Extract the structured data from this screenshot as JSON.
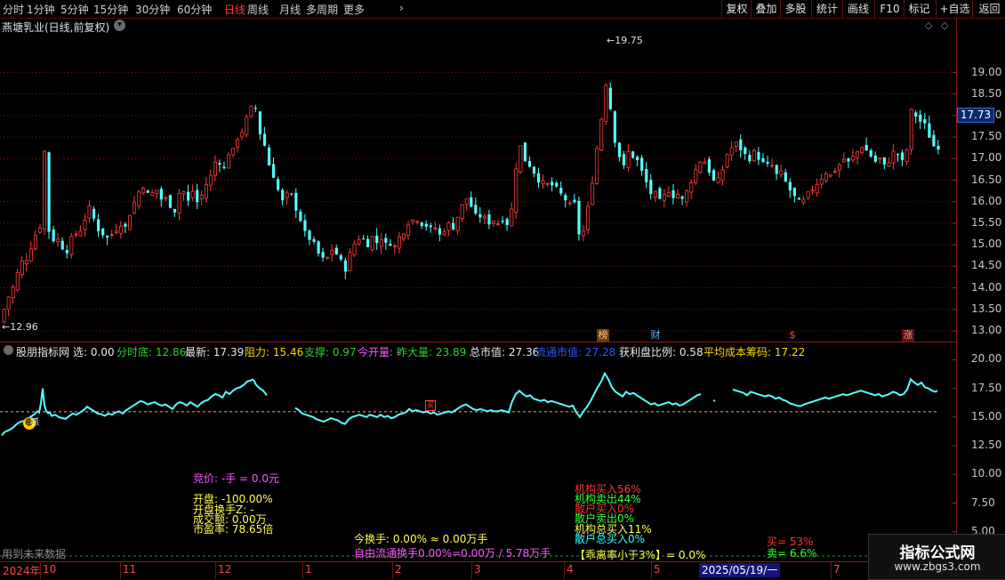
{
  "toolbar": {
    "periods": [
      "分时",
      "1分钟",
      "5分钟",
      "15分钟",
      "30分钟",
      "60分钟",
      "日线",
      "周线",
      "月线",
      "多周期",
      "更多"
    ],
    "active_period": "日线",
    "more_chevron": "›",
    "buttons": [
      "复权",
      "叠加",
      "多股",
      "统计",
      "画线",
      "F10",
      "标记",
      "+自选",
      "返回"
    ]
  },
  "main_chart": {
    "title": "燕塘乳业(日线,前复权)",
    "high_label": "19.75",
    "low_label": "12.96",
    "last_price": "17.73",
    "y_ticks": [
      "19.00",
      "18.50",
      "18.00",
      "17.50",
      "17.00",
      "16.50",
      "16.00",
      "15.50",
      "15.00",
      "14.50",
      "14.00",
      "13.50",
      "13.00"
    ],
    "y_range": [
      12.75,
      20.25
    ],
    "annotations": [
      "榜",
      "财",
      "$",
      "涨"
    ]
  },
  "indicator": {
    "name": "股朋指标网",
    "select": "选: 0.00",
    "fields": [
      {
        "text": "分时底: 12.86",
        "color": "#33cc33"
      },
      {
        "text": "最新: 17.39",
        "color": "#e8e8e8"
      },
      {
        "text": "阻力: 15.46",
        "color": "#ffd700"
      },
      {
        "text": "支撑: 0.97",
        "color": "#33cc33"
      },
      {
        "text": "今开量: -",
        "color": "#ff55ff"
      },
      {
        "text": "昨大量: 23.89",
        "color": "#33cc33"
      },
      {
        "text": "总市值: 27.36",
        "color": "#e8e8e8"
      },
      {
        "text": "流通市值: 27.28",
        "color": "#3355ff"
      },
      {
        "text": "获利盘比例: 0.58",
        "color": "#e8e8e8"
      },
      {
        "text": "平均成本筹码: 17.22",
        "color": "#ffd700"
      }
    ],
    "y_ticks": [
      "20.00",
      "17.50",
      "15.00",
      "12.50",
      "10.00",
      "7.50",
      "5.00"
    ],
    "marker_label": "抓",
    "box_label": "买"
  },
  "info": {
    "bid": "竞价: -手 = 0.0元",
    "open": "开盘: -100.00%",
    "open_turnover": "开盘换手Z: -",
    "amount": "成交额: 0.00万",
    "pe": "市盈率: 78.65倍",
    "turnover": "今换手: 0.00% ≈ 0.00万手",
    "float_line": "自由流通换手0.00%=0.00万 / 5.78万手",
    "inst_buy": "机构买入56%",
    "inst_sell": "机构卖出44%",
    "retail_buy": "散户买入0%",
    "retail_sell": "散户卖出0%",
    "inst_total_buy": "机构总买入11%",
    "retail_total_buy": "散户总买入0%",
    "divergence": "【乖离率小于3%】= 0.0%",
    "buy_pct": "买= 53%",
    "sell_pct": "卖= 6.6%",
    "future_data": "用到未来数据"
  },
  "date_axis": {
    "year": "2024年",
    "months": [
      "10",
      "11",
      "12",
      "1",
      "2",
      "3",
      "4",
      "5",
      "6",
      "7"
    ],
    "cursor_date": "2025/05/19/一"
  },
  "watermark": {
    "title": "指标公式网",
    "url": "www.zbgs3.com"
  },
  "colors": {
    "up": "#ff3b3b",
    "down": "#54ffff",
    "grid": "#7a1010",
    "line": "#54ffff",
    "dashed": "#ff9999"
  },
  "chart_data": {
    "type": "candlestick",
    "title": "燕塘乳业(日线,前复权)",
    "ylim": [
      12.75,
      20.25
    ],
    "keypoints": [
      [
        0,
        13.2
      ],
      [
        5,
        13.7
      ],
      [
        10,
        13.85
      ],
      [
        15,
        14.1
      ],
      [
        19,
        14.4
      ],
      [
        23,
        14.6
      ],
      [
        30,
        14.7
      ],
      [
        34,
        15.0
      ],
      [
        38,
        15.2
      ],
      [
        42,
        15.5
      ],
      [
        44,
        15.4
      ],
      [
        46,
        16.2
      ],
      [
        48,
        17.5
      ],
      [
        50,
        16.0
      ],
      [
        53,
        15.3
      ],
      [
        56,
        15.4
      ],
      [
        58,
        15.1
      ],
      [
        62,
        15.2
      ],
      [
        66,
        15.0
      ],
      [
        70,
        14.9
      ],
      [
        74,
        14.85
      ],
      [
        78,
        15.1
      ],
      [
        82,
        15.3
      ],
      [
        86,
        15.2
      ],
      [
        90,
        15.4
      ],
      [
        94,
        15.6
      ],
      [
        98,
        15.9
      ],
      [
        102,
        15.7
      ],
      [
        106,
        15.5
      ],
      [
        110,
        15.3
      ],
      [
        114,
        15.25
      ],
      [
        118,
        15.1
      ],
      [
        122,
        15.3
      ],
      [
        126,
        15.2
      ],
      [
        130,
        15.4
      ],
      [
        134,
        15.5
      ],
      [
        138,
        15.3
      ],
      [
        142,
        15.6
      ],
      [
        146,
        15.8
      ],
      [
        150,
        16.0
      ],
      [
        154,
        16.2
      ],
      [
        158,
        16.4
      ],
      [
        162,
        16.3
      ],
      [
        166,
        16.1
      ],
      [
        170,
        16.2
      ],
      [
        174,
        16.3
      ],
      [
        178,
        16.1
      ],
      [
        182,
        16.0
      ],
      [
        186,
        16.1
      ],
      [
        190,
        15.9
      ],
      [
        194,
        15.7
      ],
      [
        198,
        16.1
      ],
      [
        202,
        16.3
      ],
      [
        206,
        16.2
      ],
      [
        210,
        16.0
      ],
      [
        214,
        16.3
      ],
      [
        218,
        16.1
      ],
      [
        222,
        15.9
      ],
      [
        226,
        16.2
      ],
      [
        230,
        16.4
      ],
      [
        234,
        16.5
      ],
      [
        238,
        16.8
      ],
      [
        242,
        17.0
      ],
      [
        246,
        16.9
      ],
      [
        250,
        16.7
      ],
      [
        254,
        17.2
      ],
      [
        258,
        17.0
      ],
      [
        262,
        17.3
      ],
      [
        266,
        17.5
      ],
      [
        270,
        17.6
      ],
      [
        274,
        17.8
      ],
      [
        278,
        18.1
      ],
      [
        282,
        18.2
      ],
      [
        285,
        18.3
      ],
      [
        288,
        17.8
      ],
      [
        292,
        17.5
      ],
      [
        296,
        17.3
      ],
      [
        300,
        16.9
      ],
      [
        304,
        16.7
      ],
      [
        308,
        16.5
      ],
      [
        312,
        16.2
      ],
      [
        316,
        16.0
      ],
      [
        320,
        16.1
      ],
      [
        324,
        16.3
      ],
      [
        328,
        16.0
      ],
      [
        332,
        15.8
      ],
      [
        336,
        15.6
      ],
      [
        340,
        15.3
      ],
      [
        344,
        15.2
      ],
      [
        348,
        15.1
      ],
      [
        352,
        15.0
      ],
      [
        356,
        14.8
      ],
      [
        360,
        14.7
      ],
      [
        364,
        14.6
      ],
      [
        368,
        14.75
      ],
      [
        372,
        14.9
      ],
      [
        376,
        14.8
      ],
      [
        380,
        14.7
      ],
      [
        384,
        14.5
      ],
      [
        388,
        14.4
      ],
      [
        392,
        14.8
      ],
      [
        396,
        15.0
      ],
      [
        400,
        15.1
      ],
      [
        404,
        15.2
      ],
      [
        408,
        15.1
      ],
      [
        412,
        15.0
      ],
      [
        416,
        15.2
      ],
      [
        420,
        15.1
      ],
      [
        424,
        15.0
      ],
      [
        428,
        15.2
      ],
      [
        432,
        15.0
      ],
      [
        436,
        15.1
      ],
      [
        440,
        14.9
      ],
      [
        444,
        15.0
      ],
      [
        448,
        15.2
      ],
      [
        452,
        15.3
      ],
      [
        456,
        15.4
      ],
      [
        460,
        15.7
      ],
      [
        464,
        15.5
      ],
      [
        468,
        15.6
      ],
      [
        472,
        15.5
      ],
      [
        476,
        15.4
      ],
      [
        480,
        15.5
      ],
      [
        484,
        15.3
      ],
      [
        488,
        15.4
      ],
      [
        492,
        15.2
      ],
      [
        496,
        15.3
      ],
      [
        500,
        15.4
      ],
      [
        504,
        15.5
      ],
      [
        508,
        15.4
      ],
      [
        512,
        15.6
      ],
      [
        516,
        15.8
      ],
      [
        520,
        16.0
      ],
      [
        524,
        16.1
      ],
      [
        528,
        15.9
      ],
      [
        532,
        15.7
      ],
      [
        536,
        15.6
      ],
      [
        540,
        15.7
      ],
      [
        544,
        15.6
      ],
      [
        548,
        15.5
      ],
      [
        552,
        15.6
      ],
      [
        556,
        15.5
      ],
      [
        560,
        15.5
      ],
      [
        564,
        15.6
      ],
      [
        568,
        15.5
      ],
      [
        572,
        15.4
      ],
      [
        576,
        16.4
      ],
      [
        580,
        17.0
      ],
      [
        584,
        17.3
      ],
      [
        588,
        17.0
      ],
      [
        592,
        16.8
      ],
      [
        596,
        16.9
      ],
      [
        600,
        16.6
      ],
      [
        604,
        16.5
      ],
      [
        608,
        16.4
      ],
      [
        612,
        16.5
      ],
      [
        616,
        16.3
      ],
      [
        620,
        16.4
      ],
      [
        624,
        16.3
      ],
      [
        628,
        16.2
      ],
      [
        632,
        16.1
      ],
      [
        636,
        16.0
      ],
      [
        640,
        15.9
      ],
      [
        644,
        16.0
      ],
      [
        648,
        15.4
      ],
      [
        652,
        15.0
      ],
      [
        656,
        15.5
      ],
      [
        660,
        15.9
      ],
      [
        664,
        16.4
      ],
      [
        668,
        17.0
      ],
      [
        672,
        17.6
      ],
      [
        676,
        18.1
      ],
      [
        680,
        18.8
      ],
      [
        684,
        18.3
      ],
      [
        688,
        17.6
      ],
      [
        692,
        17.2
      ],
      [
        696,
        17.0
      ],
      [
        700,
        16.8
      ],
      [
        704,
        17.2
      ],
      [
        708,
        17.0
      ],
      [
        712,
        17.1
      ],
      [
        716,
        16.9
      ],
      [
        720,
        16.7
      ],
      [
        724,
        16.5
      ],
      [
        728,
        16.3
      ],
      [
        732,
        16.1
      ],
      [
        736,
        16.2
      ],
      [
        740,
        16.0
      ],
      [
        744,
        16.1
      ],
      [
        748,
        16.2
      ],
      [
        752,
        16.3
      ],
      [
        756,
        16.1
      ],
      [
        760,
        16.2
      ],
      [
        764,
        16.0
      ],
      [
        768,
        16.1
      ],
      [
        772,
        16.3
      ],
      [
        776,
        16.5
      ],
      [
        780,
        16.7
      ],
      [
        784,
        16.9
      ],
      [
        788,
        17.0
      ],
      [
        792,
        16.9
      ],
      [
        796,
        16.7
      ],
      [
        800,
        16.5
      ],
      [
        804,
        16.4
      ],
      [
        808,
        16.6
      ],
      [
        812,
        16.8
      ],
      [
        816,
        17.1
      ],
      [
        820,
        17.2
      ],
      [
        824,
        17.4
      ],
      [
        828,
        17.3
      ],
      [
        832,
        17.2
      ],
      [
        836,
        17.1
      ],
      [
        840,
        16.9
      ],
      [
        844,
        17.2
      ],
      [
        848,
        17.1
      ],
      [
        852,
        17.0
      ],
      [
        856,
        16.9
      ],
      [
        860,
        16.8
      ],
      [
        864,
        16.9
      ],
      [
        868,
        16.8
      ],
      [
        872,
        16.6
      ],
      [
        876,
        16.7
      ],
      [
        880,
        16.5
      ],
      [
        884,
        16.4
      ],
      [
        888,
        16.2
      ],
      [
        892,
        16.1
      ],
      [
        896,
        16.0
      ],
      [
        900,
        15.95
      ],
      [
        904,
        16.1
      ],
      [
        908,
        16.2
      ],
      [
        912,
        16.3
      ],
      [
        916,
        16.4
      ],
      [
        920,
        16.5
      ],
      [
        924,
        16.6
      ],
      [
        928,
        16.7
      ],
      [
        932,
        16.6
      ],
      [
        936,
        16.7
      ],
      [
        940,
        16.8
      ],
      [
        944,
        16.9
      ],
      [
        948,
        17.0
      ],
      [
        952,
        16.9
      ],
      [
        956,
        17.0
      ],
      [
        960,
        17.1
      ],
      [
        964,
        17.2
      ],
      [
        968,
        17.3
      ],
      [
        972,
        17.2
      ],
      [
        976,
        17.1
      ],
      [
        980,
        17.0
      ],
      [
        984,
        16.9
      ],
      [
        988,
        17.0
      ],
      [
        992,
        16.8
      ],
      [
        996,
        16.9
      ],
      [
        1000,
        17.0
      ],
      [
        1004,
        17.2
      ],
      [
        1008,
        17.1
      ],
      [
        1012,
        16.9
      ],
      [
        1016,
        17.0
      ],
      [
        1020,
        17.4
      ],
      [
        1024,
        18.3
      ],
      [
        1028,
        18.0
      ],
      [
        1032,
        17.8
      ],
      [
        1036,
        18.0
      ],
      [
        1040,
        17.6
      ],
      [
        1044,
        17.5
      ],
      [
        1048,
        17.3
      ],
      [
        1052,
        17.2
      ],
      [
        1056,
        17.4
      ]
    ]
  }
}
